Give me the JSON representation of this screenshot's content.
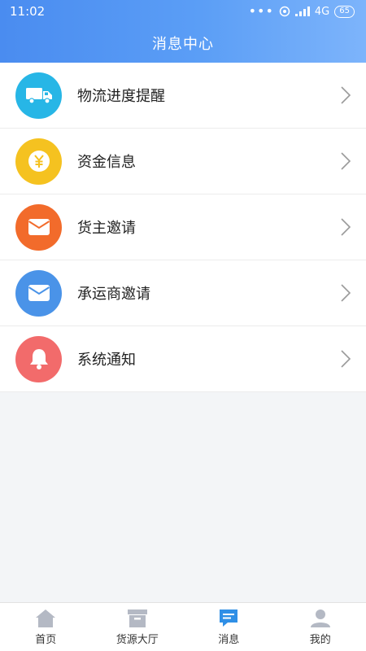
{
  "status_bar": {
    "time": "11:02",
    "network": "4G",
    "battery": "65"
  },
  "header": {
    "title": "消息中心"
  },
  "items": [
    {
      "label": "物流进度提醒",
      "icon": "truck-icon",
      "color": "#27b6e6"
    },
    {
      "label": "资金信息",
      "icon": "yuan-coin-icon",
      "color": "#f5c220"
    },
    {
      "label": "货主邀请",
      "icon": "envelope-icon",
      "color": "#f26b2b"
    },
    {
      "label": "承运商邀请",
      "icon": "envelope-icon",
      "color": "#4a93e8"
    },
    {
      "label": "系统通知",
      "icon": "bell-icon",
      "color": "#f26b6b"
    }
  ],
  "tabs": [
    {
      "label": "首页",
      "icon": "home-icon",
      "active": false
    },
    {
      "label": "货源大厅",
      "icon": "archive-box-icon",
      "active": false
    },
    {
      "label": "消息",
      "icon": "message-icon",
      "active": true
    },
    {
      "label": "我的",
      "icon": "user-icon",
      "active": false
    }
  ],
  "colors": {
    "header_start": "#4a8cf0",
    "header_end": "#7db4fb",
    "tab_active": "#2f8fe6",
    "tab_inactive": "#b4b9c4"
  }
}
